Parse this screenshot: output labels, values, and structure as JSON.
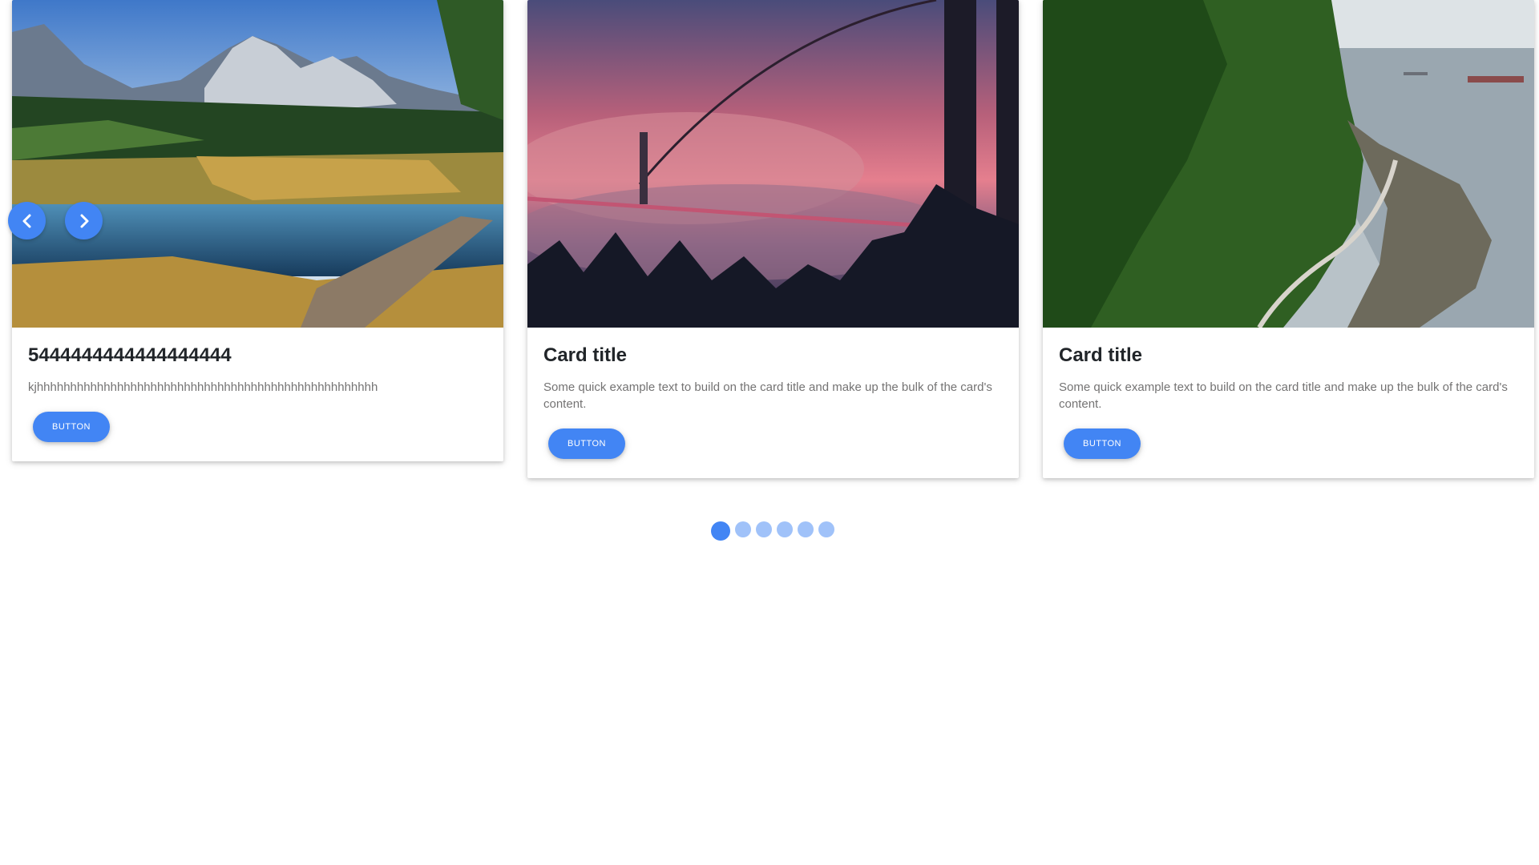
{
  "carousel": {
    "cards": [
      {
        "title": "5444444444444444444",
        "text": "kjhhhhhhhhhhhhhhhhhhhhhhhhhhhhhhhhhhhhhhhhhhhhhhhhhhh",
        "button": "BUTTON",
        "image": "mountain-lake-landscape"
      },
      {
        "title": "Card title",
        "text": "Some quick example text to build on the card title and make up the bulk of the card's content.",
        "button": "BUTTON",
        "image": "suspension-bridge-pink-fog"
      },
      {
        "title": "Card title",
        "text": "Some quick example text to build on the card title and make up the bulk of the card's content.",
        "button": "BUTTON",
        "image": "forest-coastline-seawall"
      }
    ],
    "controls": {
      "prev_icon": "chevron-left-icon",
      "next_icon": "chevron-right-icon"
    },
    "indicators": {
      "count": 6,
      "active_index": 0
    },
    "accent_color": "#4285f4"
  }
}
